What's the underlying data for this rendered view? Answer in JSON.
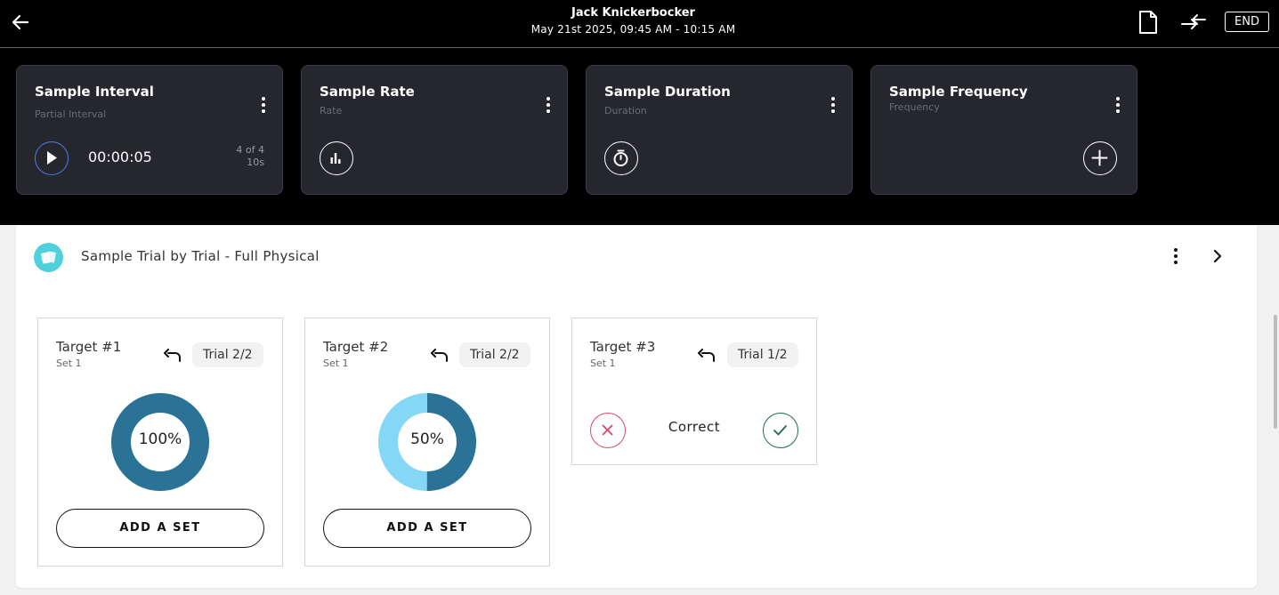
{
  "header": {
    "client_name": "Jack Knickerbocker",
    "session_time": "May 21st 2025, 09:45 AM - 10:15 AM",
    "end_label": "END",
    "icons": [
      "arrow-left-icon",
      "document-icon",
      "swap-arrows-icon"
    ]
  },
  "data_cards": [
    {
      "title": "Sample Interval",
      "subtitle": "Partial Interval",
      "timer": "00:00:05",
      "count_line1": "4 of 4",
      "count_line2": "10s",
      "action_icon": "play-icon"
    },
    {
      "title": "Sample Rate",
      "subtitle": "Rate",
      "action_icon": "bar-chart-icon"
    },
    {
      "title": "Sample Duration",
      "subtitle": "Duration",
      "action_icon": "stopwatch-icon"
    },
    {
      "title": "Sample Frequency",
      "subtitle": "Frequency",
      "action_icon": "plus-icon"
    }
  ],
  "program": {
    "title": "Sample Trial by Trial - Full Physical",
    "icon": "cards-icon"
  },
  "targets": [
    {
      "name": "Target #1",
      "set": "Set 1",
      "trial": "Trial 2/2",
      "percent_label": "100%",
      "percent": 100,
      "add_set_label": "ADD A SET"
    },
    {
      "name": "Target #2",
      "set": "Set 1",
      "trial": "Trial 2/2",
      "percent_label": "50%",
      "percent": 50,
      "add_set_label": "ADD A SET"
    },
    {
      "name": "Target #3",
      "set": "Set 1",
      "trial": "Trial 1/2",
      "prompt_label": "Correct"
    }
  ],
  "colors": {
    "accent_teal": "#4fd0da",
    "donut_dark": "#2b7396",
    "donut_light": "#84d8f5",
    "incorrect_red": "#d84a6a",
    "correct_green": "#1e6b4e"
  }
}
